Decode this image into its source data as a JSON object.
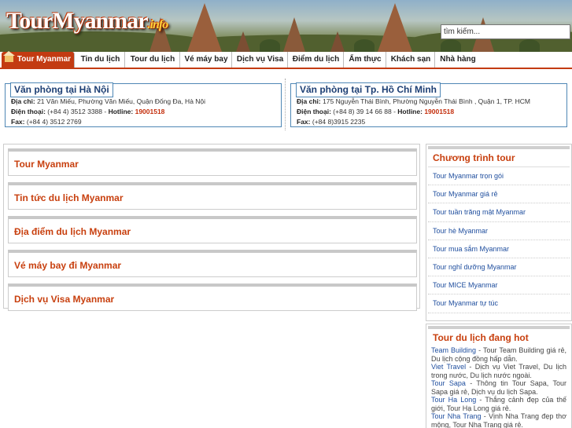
{
  "header": {
    "logo_text": "TourMyanmar",
    "logo_domain": ".info",
    "search_placeholder": "tìm kiếm..."
  },
  "nav": {
    "items": [
      {
        "label": "Tour Myanmar",
        "active": true
      },
      {
        "label": "Tin du lịch"
      },
      {
        "label": "Tour du lịch"
      },
      {
        "label": "Vé máy bay"
      },
      {
        "label": "Dịch vụ Visa"
      },
      {
        "label": "Điểm du lịch"
      },
      {
        "label": "Ẩm thực"
      },
      {
        "label": "Khách sạn"
      },
      {
        "label": "Nhà hàng"
      }
    ]
  },
  "offices": {
    "hanoi": {
      "title": "Văn phòng tại Hà Nội",
      "address_label": "Địa chỉ:",
      "address": "21 Văn Miếu, Phường Văn Miếu, Quận Đống Đa, Hà Nội",
      "phone_label": "Điện thoại:",
      "phone": "(+84 4) 3512 3388",
      "hotline_label": "Hotline:",
      "hotline": "19001518",
      "fax_label": "Fax:",
      "fax": "(+84 4) 3512 2769"
    },
    "hcm": {
      "title": "Văn phòng tại Tp. Hồ Chí Minh",
      "address_label": "Địa chỉ:",
      "address": "175 Nguyễn Thái Bình, Phường Nguyễn Thái Bình , Quận 1, TP. HCM",
      "phone_label": "Điện thoại:",
      "phone": "(+84 8) 39 14 66 88",
      "hotline_label": "Hotline:",
      "hotline": "19001518",
      "fax_label": "Fax:",
      "fax": "(+84 8)3915 2235"
    }
  },
  "main": {
    "sections": [
      "Tour Myanmar",
      "Tin tức du lịch Myanmar",
      "Địa điểm du lịch Myanmar",
      "Vé máy bay đi Myanmar",
      "Dịch vụ Visa Myanmar"
    ]
  },
  "sidebar": {
    "programs_title": "Chương trình tour",
    "programs": [
      "Tour Myanmar trọn gói",
      "Tour Myanmar giá rẻ",
      "Tour tuần trăng mật Myanmar",
      "Tour hè Myanmar",
      "Tour mua sắm Myanmar",
      "Tour nghỉ dưỡng Myanmar",
      "Tour MICE Myanmar",
      "Tour Myanmar tự túc"
    ],
    "hot_title": "Tour du lịch đang hot",
    "hot": [
      {
        "link": "Team Building",
        "text": " - Tour Team Building giá rẻ, Du lịch cộng đồng hấp dẫn."
      },
      {
        "link": "Viet Travel",
        "text": " - Dịch vụ Viet Travel, Du lịch trong nước, Du lịch nước ngoài."
      },
      {
        "link": "Tour Sapa",
        "text": " - Thông tin Tour Sapa, Tour Sapa giá rẻ, Dịch vụ du lịch Sapa."
      },
      {
        "link": "Tour Ha Long",
        "text": " - Thắng cảnh đẹp của thế giới, Tour Hạ Long giá rẻ."
      },
      {
        "link": "Tour Nha Trang",
        "text": " - Vịnh Nha Trang đẹp thơ mộng, Tour Nha Trang giá rẻ."
      }
    ]
  }
}
